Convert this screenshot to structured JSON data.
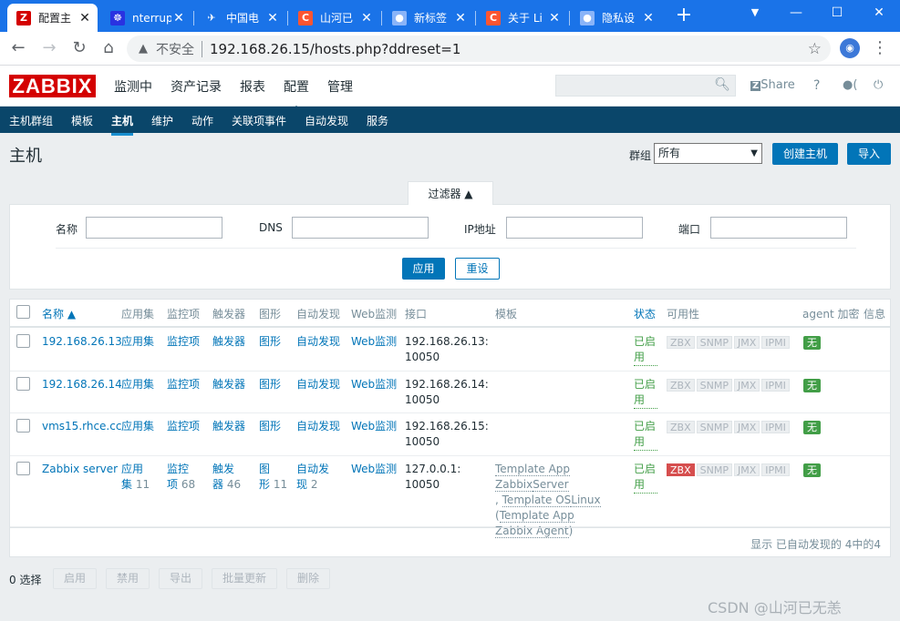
{
  "browser": {
    "tabs": [
      {
        "title": "配置主",
        "fav_text": "Z",
        "fav_color": "#d40000",
        "active": true
      },
      {
        "title": "nterrup",
        "fav_text": "☸",
        "fav_color": "#2932e1",
        "active": false
      },
      {
        "title": "中国电",
        "fav_text": "✈",
        "fav_color": "#1a73e8",
        "active": false
      },
      {
        "title": "山河已",
        "fav_text": "C",
        "fav_color": "#fc5531",
        "active": false
      },
      {
        "title": "新标签",
        "fav_text": "●",
        "fav_color": "#8ab4f8",
        "active": false
      },
      {
        "title": "关于 Li",
        "fav_text": "C",
        "fav_color": "#fc5531",
        "active": false
      },
      {
        "title": "隐私设",
        "fav_text": "●",
        "fav_color": "#8ab4f8",
        "active": false
      }
    ],
    "insecure_label": "不安全",
    "url": "192.168.26.15/hosts.php?ddreset=1"
  },
  "header": {
    "logo": "ZABBIX",
    "menu": [
      "监测中",
      "资产记录",
      "报表",
      "配置",
      "管理"
    ],
    "share": "Share",
    "help": "?",
    "user_icon": "●(",
    "logout_icon": "⏻"
  },
  "submenu": [
    "主机群组",
    "模板",
    "主机",
    "维护",
    "动作",
    "关联项事件",
    "自动发现",
    "服务"
  ],
  "page": {
    "title": "主机",
    "group_label": "群组",
    "group_value": "所有",
    "create_button": "创建主机",
    "import_button": "导入"
  },
  "filter": {
    "tab_label": "过滤器 ▲",
    "fields": [
      {
        "label": "名称",
        "value": ""
      },
      {
        "label": "DNS",
        "value": ""
      },
      {
        "label": "IP地址",
        "value": ""
      },
      {
        "label": "端口",
        "value": ""
      }
    ],
    "apply": "应用",
    "reset": "重设"
  },
  "table": {
    "headers": [
      "名称 ▲",
      "应用集",
      "监控项",
      "触发器",
      "图形",
      "自动发现",
      "Web监测",
      "接口",
      "模板",
      "状态",
      "可用性",
      "agent 加密",
      "信息"
    ],
    "rows": [
      {
        "name": "192.168.26.13",
        "apps": "应用集",
        "apps_count": "",
        "items": "监控项",
        "items_count": "",
        "triggers": "触发器",
        "triggers_count": "",
        "graphs": "图形",
        "graphs_count": "",
        "discovery": "自动发现",
        "discovery_count": "",
        "web": "Web监测",
        "iface1": "192.168.26.13:",
        "iface2": "10050",
        "templates": "",
        "status": "已启用",
        "avail": [
          "ZBX",
          "SNMP",
          "JMX",
          "IPMI"
        ],
        "zbx_red": false,
        "encryption": "无"
      },
      {
        "name": "192.168.26.14",
        "apps": "应用集",
        "apps_count": "",
        "items": "监控项",
        "items_count": "",
        "triggers": "触发器",
        "triggers_count": "",
        "graphs": "图形",
        "graphs_count": "",
        "discovery": "自动发现",
        "discovery_count": "",
        "web": "Web监测",
        "iface1": "192.168.26.14:",
        "iface2": "10050",
        "templates": "",
        "status": "已启用",
        "avail": [
          "ZBX",
          "SNMP",
          "JMX",
          "IPMI"
        ],
        "zbx_red": false,
        "encryption": "无"
      },
      {
        "name": "vms15.rhce.cc",
        "apps": "应用集",
        "apps_count": "",
        "items": "监控项",
        "items_count": "",
        "triggers": "触发器",
        "triggers_count": "",
        "graphs": "图形",
        "graphs_count": "",
        "discovery": "自动发现",
        "discovery_count": "",
        "web": "Web监测",
        "iface1": "192.168.26.15:",
        "iface2": "10050",
        "templates": "",
        "status": "已启用",
        "avail": [
          "ZBX",
          "SNMP",
          "JMX",
          "IPMI"
        ],
        "zbx_red": false,
        "encryption": "无"
      },
      {
        "name": "Zabbix server",
        "apps": "应用",
        "apps2": "集",
        "apps_count": "11",
        "items": "监控",
        "items2": "项",
        "items_count": "68",
        "triggers": "触发",
        "triggers2": "器",
        "triggers_count": "46",
        "graphs": "图",
        "graphs2": "形",
        "graphs_count": "11",
        "discovery": "自动发",
        "discovery2": "现",
        "discovery_count": "2",
        "web": "Web监测",
        "iface1": "127.0.0.1:",
        "iface2": "10050",
        "templates": [
          "Template App Zabbix",
          "Server",
          ", ",
          "Template OS",
          "Linux",
          " (",
          "Template App",
          "Zabbix Agent",
          ")"
        ],
        "status": "已启用",
        "avail": [
          "ZBX",
          "SNMP",
          "JMX",
          "IPMI"
        ],
        "zbx_red": true,
        "encryption": "无"
      }
    ],
    "footer": "显示 已自动发现的 4中的4"
  },
  "actions": {
    "selected": "0 选择",
    "buttons": [
      "启用",
      "禁用",
      "导出",
      "批量更新",
      "删除"
    ]
  },
  "watermark": "CSDN @山河已无恙"
}
